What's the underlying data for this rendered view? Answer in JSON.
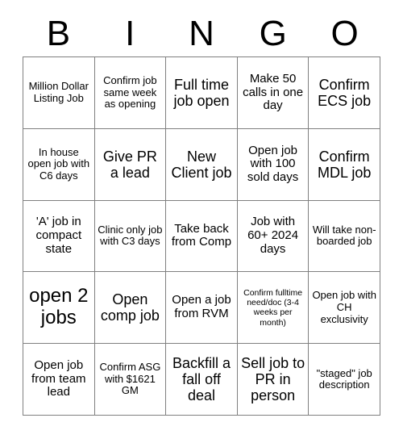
{
  "header": {
    "letters": [
      "B",
      "I",
      "N",
      "G",
      "O"
    ]
  },
  "grid": {
    "rows": 5,
    "columns": 5,
    "border_color": "#808080",
    "background_color": "#ffffff",
    "text_color": "#000000",
    "cells": [
      {
        "text": "Million Dollar Listing Job",
        "size": "sm"
      },
      {
        "text": "Confirm job same week as opening",
        "size": "sm"
      },
      {
        "text": "Full time job open",
        "size": "lg"
      },
      {
        "text": "Make 50 calls in one day",
        "size": "md"
      },
      {
        "text": "Confirm ECS job",
        "size": "lg"
      },
      {
        "text": "In house open job with C6 days",
        "size": "sm"
      },
      {
        "text": "Give PR a lead",
        "size": "lg"
      },
      {
        "text": "New Client job",
        "size": "lg"
      },
      {
        "text": "Open job with 100 sold days",
        "size": "md"
      },
      {
        "text": "Confirm MDL job",
        "size": "lg"
      },
      {
        "text": "'A' job in compact state",
        "size": "md"
      },
      {
        "text": "Clinic only job with C3 days",
        "size": "sm"
      },
      {
        "text": "Take back from Comp",
        "size": "md"
      },
      {
        "text": "Job with 60+ 2024 days",
        "size": "md"
      },
      {
        "text": "Will take non-boarded job",
        "size": "sm"
      },
      {
        "text": "open 2 jobs",
        "size": "xl"
      },
      {
        "text": "Open comp job",
        "size": "lg"
      },
      {
        "text": "Open a job from RVM",
        "size": "md"
      },
      {
        "text": "Confirm fulltime need/doc (3-4 weeks per month)",
        "size": "xs"
      },
      {
        "text": "Open job with CH exclusivity",
        "size": "sm"
      },
      {
        "text": "Open job from team lead",
        "size": "md"
      },
      {
        "text": "Confirm ASG with $1621 GM",
        "size": "sm"
      },
      {
        "text": "Backfill a fall off deal",
        "size": "lg"
      },
      {
        "text": "Sell job to PR in person",
        "size": "lg"
      },
      {
        "text": "\"staged\" job description",
        "size": "sm"
      }
    ]
  }
}
